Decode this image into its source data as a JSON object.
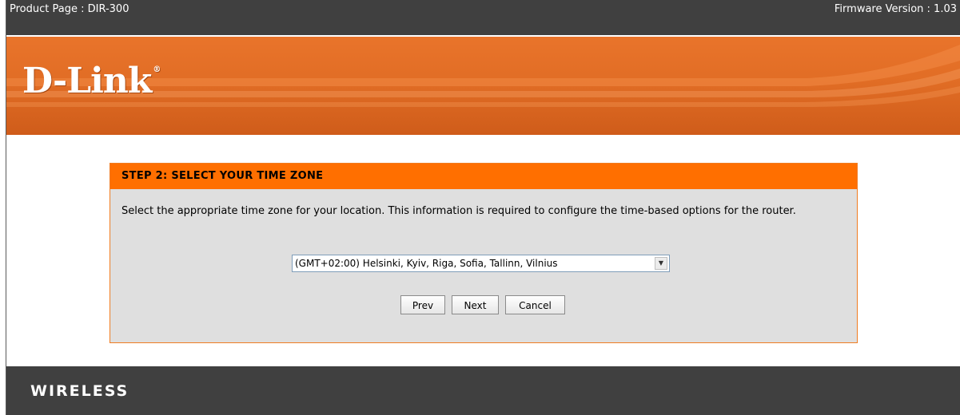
{
  "topbar": {
    "product": "Product Page :  DIR-300",
    "firmware": "Firmware Version : 1.03"
  },
  "banner": {
    "logo": "D-Link",
    "logo_mark": "®"
  },
  "wizard": {
    "title": "STEP 2: SELECT YOUR TIME ZONE",
    "description": "Select the appropriate time zone for your location. This information is required to configure the time-based options for the router.",
    "timezone_selected": "(GMT+02:00) Helsinki, Kyiv, Riga, Sofia, Tallinn, Vilnius",
    "buttons": {
      "prev": "Prev",
      "next": "Next",
      "cancel": "Cancel"
    }
  },
  "footer": {
    "brand": "WIRELESS"
  },
  "colors": {
    "orange": "#ff6f00",
    "dark": "#404040",
    "panel": "#dfdfdf"
  },
  "icons": {
    "dropdown": "chevron-down-icon"
  }
}
